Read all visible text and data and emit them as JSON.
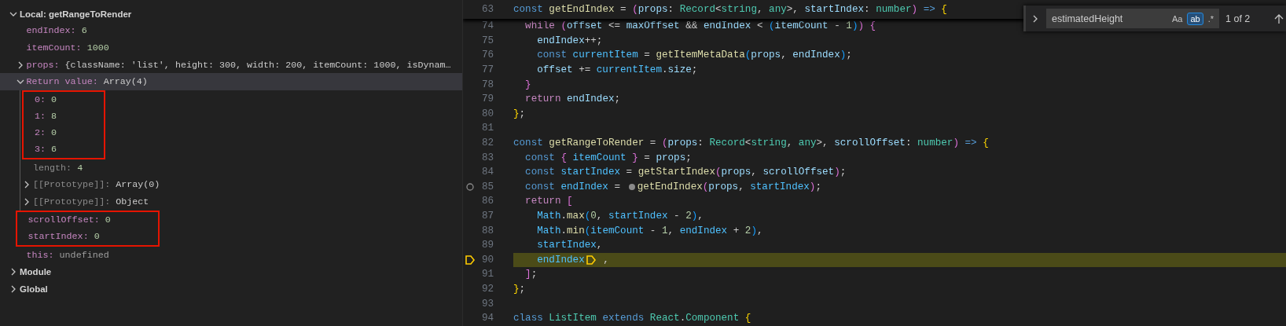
{
  "variables": {
    "scopes": [
      {
        "label": "Local: getRangeToRender",
        "expanded": true,
        "selected": false,
        "children": [
          {
            "name": "endIndex:",
            "value": "6",
            "kind": "number",
            "internal": false,
            "selected": false,
            "boxed": false
          },
          {
            "name": "itemCount:",
            "value": "1000",
            "kind": "number",
            "internal": false,
            "selected": false,
            "boxed": false
          },
          {
            "name": "props:",
            "value": "{className: 'list', height: 300, width: 200, itemCount: 1000, isDynam…",
            "kind": "object",
            "internal": false,
            "expanded": false,
            "selected": false,
            "boxed": false
          },
          {
            "name": "Return value:",
            "value": "Array(4)",
            "kind": "object",
            "internal": false,
            "expanded": true,
            "selected": true,
            "boxed": false,
            "children": [
              {
                "name": "0:",
                "value": "0",
                "kind": "number",
                "internal": false,
                "selected": false,
                "boxed": true
              },
              {
                "name": "1:",
                "value": "8",
                "kind": "number",
                "internal": false,
                "selected": false,
                "boxed": true
              },
              {
                "name": "2:",
                "value": "0",
                "kind": "number",
                "internal": false,
                "selected": false,
                "boxed": true
              },
              {
                "name": "3:",
                "value": "6",
                "kind": "number",
                "internal": false,
                "selected": false,
                "boxed": true
              },
              {
                "name": "length:",
                "value": "4",
                "kind": "number",
                "internal": true,
                "selected": false,
                "boxed": false
              },
              {
                "name": "[[Prototype]]:",
                "value": "Array(0)",
                "kind": "object",
                "internal": true,
                "expanded": false,
                "selected": false,
                "boxed": false
              },
              {
                "name": "[[Prototype]]:",
                "value": "Object",
                "kind": "object",
                "internal": true,
                "expanded": false,
                "selected": false,
                "boxed": false
              }
            ]
          },
          {
            "name": "scrollOffset:",
            "value": "0",
            "kind": "number",
            "internal": false,
            "selected": false,
            "boxed": true
          },
          {
            "name": "startIndex:",
            "value": "0",
            "kind": "number",
            "internal": false,
            "selected": false,
            "boxed": true
          },
          {
            "name": "this:",
            "value": "undefined",
            "kind": "undefined",
            "internal": false,
            "selected": false,
            "boxed": false
          }
        ]
      },
      {
        "label": "Module",
        "expanded": false,
        "selected": false
      },
      {
        "label": "Global",
        "expanded": false,
        "selected": false
      }
    ]
  },
  "editor": {
    "sticky_line": {
      "number": "63",
      "tokens": [
        {
          "text": "const ",
          "kind": "kw"
        },
        {
          "text": "getEndIndex",
          "kind": "fn"
        },
        {
          "text": " = ",
          "kind": "p"
        },
        {
          "text": "(",
          "kind": "b2"
        },
        {
          "text": "props",
          "kind": "var"
        },
        {
          "text": ": ",
          "kind": "p"
        },
        {
          "text": "Record",
          "kind": "type"
        },
        {
          "text": "<",
          "kind": "p"
        },
        {
          "text": "string",
          "kind": "type"
        },
        {
          "text": ", ",
          "kind": "p"
        },
        {
          "text": "any",
          "kind": "type"
        },
        {
          "text": ">, ",
          "kind": "p"
        },
        {
          "text": "startIndex",
          "kind": "var"
        },
        {
          "text": ": ",
          "kind": "p"
        },
        {
          "text": "number",
          "kind": "type"
        },
        {
          "text": ")",
          "kind": "b2"
        },
        {
          "text": " => ",
          "kind": "kw"
        },
        {
          "text": "{",
          "kind": "b1"
        }
      ]
    },
    "lines": [
      {
        "number": "74",
        "current": false,
        "breakpoint": false,
        "tokens": [
          {
            "text": "  while ",
            "kind": "ctl"
          },
          {
            "text": "(",
            "kind": "b2"
          },
          {
            "text": "offset",
            "kind": "var"
          },
          {
            "text": " <= ",
            "kind": "p"
          },
          {
            "text": "maxOffset",
            "kind": "var"
          },
          {
            "text": " && ",
            "kind": "p"
          },
          {
            "text": "endIndex",
            "kind": "var"
          },
          {
            "text": " < ",
            "kind": "p"
          },
          {
            "text": "(",
            "kind": "b3"
          },
          {
            "text": "itemCount",
            "kind": "var"
          },
          {
            "text": " - ",
            "kind": "p"
          },
          {
            "text": "1",
            "kind": "num"
          },
          {
            "text": ")",
            "kind": "b3"
          },
          {
            "text": ")",
            "kind": "b2"
          },
          {
            "text": " {",
            "kind": "b2"
          }
        ]
      },
      {
        "number": "75",
        "current": false,
        "breakpoint": false,
        "tokens": [
          {
            "text": "    endIndex",
            "kind": "var"
          },
          {
            "text": "++;",
            "kind": "p"
          }
        ]
      },
      {
        "number": "76",
        "current": false,
        "breakpoint": false,
        "tokens": [
          {
            "text": "    const ",
            "kind": "kw"
          },
          {
            "text": "currentItem",
            "kind": "const"
          },
          {
            "text": " = ",
            "kind": "p"
          },
          {
            "text": "getItemMetaData",
            "kind": "fn"
          },
          {
            "text": "(",
            "kind": "b3"
          },
          {
            "text": "props",
            "kind": "var"
          },
          {
            "text": ", ",
            "kind": "p"
          },
          {
            "text": "endIndex",
            "kind": "var"
          },
          {
            "text": ")",
            "kind": "b3"
          },
          {
            "text": ";",
            "kind": "p"
          }
        ]
      },
      {
        "number": "77",
        "current": false,
        "breakpoint": false,
        "tokens": [
          {
            "text": "    offset",
            "kind": "var"
          },
          {
            "text": " += ",
            "kind": "p"
          },
          {
            "text": "currentItem",
            "kind": "const"
          },
          {
            "text": ".",
            "kind": "p"
          },
          {
            "text": "size",
            "kind": "var"
          },
          {
            "text": ";",
            "kind": "p"
          }
        ]
      },
      {
        "number": "78",
        "current": false,
        "breakpoint": false,
        "tokens": [
          {
            "text": "  }",
            "kind": "b2"
          }
        ]
      },
      {
        "number": "79",
        "current": false,
        "breakpoint": false,
        "tokens": [
          {
            "text": "  return ",
            "kind": "ctl"
          },
          {
            "text": "endIndex",
            "kind": "var"
          },
          {
            "text": ";",
            "kind": "p"
          }
        ]
      },
      {
        "number": "80",
        "current": false,
        "breakpoint": false,
        "tokens": [
          {
            "text": "}",
            "kind": "b1"
          },
          {
            "text": ";",
            "kind": "p"
          }
        ]
      },
      {
        "number": "81",
        "current": false,
        "breakpoint": false
      },
      {
        "number": "82",
        "current": false,
        "breakpoint": false,
        "tokens": [
          {
            "text": "const ",
            "kind": "kw"
          },
          {
            "text": "getRangeToRender",
            "kind": "fn"
          },
          {
            "text": " = ",
            "kind": "p"
          },
          {
            "text": "(",
            "kind": "b2"
          },
          {
            "text": "props",
            "kind": "var"
          },
          {
            "text": ": ",
            "kind": "p"
          },
          {
            "text": "Record",
            "kind": "type"
          },
          {
            "text": "<",
            "kind": "p"
          },
          {
            "text": "string",
            "kind": "type"
          },
          {
            "text": ", ",
            "kind": "p"
          },
          {
            "text": "any",
            "kind": "type"
          },
          {
            "text": ">, ",
            "kind": "p"
          },
          {
            "text": "scrollOffset",
            "kind": "var"
          },
          {
            "text": ": ",
            "kind": "p"
          },
          {
            "text": "number",
            "kind": "type"
          },
          {
            "text": ")",
            "kind": "b2"
          },
          {
            "text": " => ",
            "kind": "kw"
          },
          {
            "text": "{",
            "kind": "b1"
          }
        ]
      },
      {
        "number": "83",
        "current": false,
        "breakpoint": false,
        "tokens": [
          {
            "text": "  const ",
            "kind": "kw"
          },
          {
            "text": "{ ",
            "kind": "b2"
          },
          {
            "text": "itemCount",
            "kind": "const"
          },
          {
            "text": " }",
            "kind": "b2"
          },
          {
            "text": " = ",
            "kind": "p"
          },
          {
            "text": "props",
            "kind": "var"
          },
          {
            "text": ";",
            "kind": "p"
          }
        ]
      },
      {
        "number": "84",
        "current": false,
        "breakpoint": false,
        "tokens": [
          {
            "text": "  const ",
            "kind": "kw"
          },
          {
            "text": "startIndex",
            "kind": "const"
          },
          {
            "text": " = ",
            "kind": "p"
          },
          {
            "text": "getStartIndex",
            "kind": "fn"
          },
          {
            "text": "(",
            "kind": "b2"
          },
          {
            "text": "props",
            "kind": "var"
          },
          {
            "text": ", ",
            "kind": "p"
          },
          {
            "text": "scrollOffset",
            "kind": "var"
          },
          {
            "text": ")",
            "kind": "b2"
          },
          {
            "text": ";",
            "kind": "p"
          }
        ]
      },
      {
        "number": "85",
        "current": false,
        "breakpoint": true,
        "tokens": [
          {
            "text": "  const ",
            "kind": "kw"
          },
          {
            "text": "endIndex",
            "kind": "const"
          },
          {
            "text": " = ",
            "kind": "p"
          },
          {
            "kind": "inline_breakpoint"
          },
          {
            "text": "getEndIndex",
            "kind": "fn"
          },
          {
            "text": "(",
            "kind": "b2"
          },
          {
            "text": "props",
            "kind": "var"
          },
          {
            "text": ", ",
            "kind": "p"
          },
          {
            "text": "startIndex",
            "kind": "const"
          },
          {
            "text": ")",
            "kind": "b2"
          },
          {
            "text": ";",
            "kind": "p"
          }
        ]
      },
      {
        "number": "86",
        "current": false,
        "breakpoint": false,
        "tokens": [
          {
            "text": "  return ",
            "kind": "ctl"
          },
          {
            "text": "[",
            "kind": "b2"
          }
        ]
      },
      {
        "number": "87",
        "current": false,
        "breakpoint": false,
        "tokens": [
          {
            "text": "    Math",
            "kind": "const"
          },
          {
            "text": ".",
            "kind": "p"
          },
          {
            "text": "max",
            "kind": "fn"
          },
          {
            "text": "(",
            "kind": "b3"
          },
          {
            "text": "0",
            "kind": "num"
          },
          {
            "text": ", ",
            "kind": "p"
          },
          {
            "text": "startIndex",
            "kind": "const"
          },
          {
            "text": " - ",
            "kind": "p"
          },
          {
            "text": "2",
            "kind": "num"
          },
          {
            "text": ")",
            "kind": "b3"
          },
          {
            "text": ",",
            "kind": "p"
          }
        ]
      },
      {
        "number": "88",
        "current": false,
        "breakpoint": false,
        "tokens": [
          {
            "text": "    Math",
            "kind": "const"
          },
          {
            "text": ".",
            "kind": "p"
          },
          {
            "text": "min",
            "kind": "fn"
          },
          {
            "text": "(",
            "kind": "b3"
          },
          {
            "text": "itemCount",
            "kind": "const"
          },
          {
            "text": " - ",
            "kind": "p"
          },
          {
            "text": "1",
            "kind": "num"
          },
          {
            "text": ", ",
            "kind": "p"
          },
          {
            "text": "endIndex",
            "kind": "const"
          },
          {
            "text": " + ",
            "kind": "p"
          },
          {
            "text": "2",
            "kind": "num"
          },
          {
            "text": ")",
            "kind": "b3"
          },
          {
            "text": ",",
            "kind": "p"
          }
        ]
      },
      {
        "number": "89",
        "current": false,
        "breakpoint": false,
        "tokens": [
          {
            "text": "    startIndex",
            "kind": "const"
          },
          {
            "text": ",",
            "kind": "p"
          }
        ]
      },
      {
        "number": "90",
        "current": true,
        "breakpoint": false,
        "tokens": [
          {
            "text": "    endIndex",
            "kind": "const"
          },
          {
            "kind": "inline_stop"
          },
          {
            "text": " ,",
            "kind": "p"
          }
        ]
      },
      {
        "number": "91",
        "current": false,
        "breakpoint": false,
        "tokens": [
          {
            "text": "  ]",
            "kind": "b2"
          },
          {
            "text": ";",
            "kind": "p"
          }
        ]
      },
      {
        "number": "92",
        "current": false,
        "breakpoint": false,
        "tokens": [
          {
            "text": "}",
            "kind": "b1"
          },
          {
            "text": ";",
            "kind": "p"
          }
        ]
      },
      {
        "number": "93",
        "current": false,
        "breakpoint": false
      },
      {
        "number": "94",
        "current": false,
        "breakpoint": false,
        "tokens": [
          {
            "text": "class ",
            "kind": "kw"
          },
          {
            "text": "ListItem",
            "kind": "type"
          },
          {
            "text": " extends ",
            "kind": "kw"
          },
          {
            "text": "React",
            "kind": "type"
          },
          {
            "text": ".",
            "kind": "p"
          },
          {
            "text": "Component",
            "kind": "type"
          },
          {
            "text": " {",
            "kind": "b1"
          }
        ]
      }
    ]
  },
  "find_widget": {
    "value": "estimatedHeight",
    "toggles": [
      {
        "label": "Aa",
        "selected": false
      },
      {
        "label": "ab",
        "selected": true
      },
      {
        "label": ".*",
        "selected": false
      }
    ],
    "match_count": "1 of 2"
  }
}
